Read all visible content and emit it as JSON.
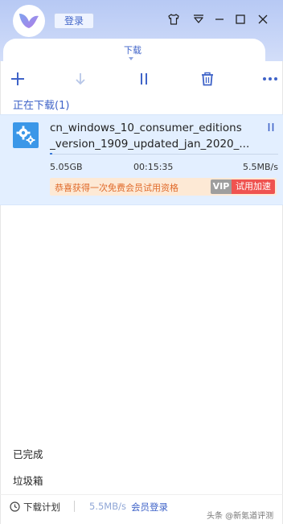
{
  "app": {
    "login_label": "登录"
  },
  "tabs": {
    "active_label": "下载"
  },
  "section": {
    "downloading_label": "正在下载(1)"
  },
  "download": {
    "file_name_line1": "cn_windows_10_consumer_editions",
    "file_name_line2": "_version_1909_updated_jan_2020_...",
    "size": "5.05GB",
    "remaining_time": "00:15:35",
    "speed": "5.5MB/s",
    "progress": 0.01,
    "promo_text": "恭喜获得一次免费会员试用资格",
    "vip_badge": "VIP",
    "trial_button": "试用加速"
  },
  "sidebar": {
    "completed_label": "已完成",
    "trash_label": "垃圾箱"
  },
  "footer": {
    "schedule_label": "下载计划",
    "speed": "5.5MB/s",
    "member_login": "会员登录"
  },
  "watermark": "头条 @新氪道评测",
  "colors": {
    "accent": "#3f63c8",
    "titlebar": "#c7d5f7",
    "item_bg": "#e3efff",
    "promo_bg": "#fde9d5",
    "trial_red": "#ef5350"
  }
}
